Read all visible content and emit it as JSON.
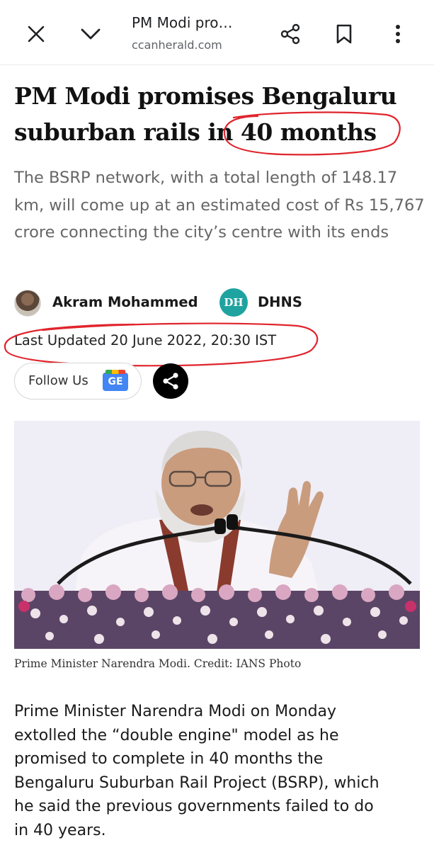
{
  "browser": {
    "title": "PM Modi pro…",
    "url": "ccanherald.com"
  },
  "icons": {
    "close": "close-icon",
    "chevron": "chevron-down-icon",
    "share": "share-icon",
    "bookmark": "bookmark-icon",
    "more": "more-vert-icon"
  },
  "article": {
    "headline_line1": "PM Modi promises Bengaluru",
    "headline_line2": "suburban rails in 40 months",
    "summary": "The BSRP network, with a total length of 148.17 km, will come up at an estimated cost of Rs 15,767 crore connecting the city’s centre with its ends",
    "author": "Akram Mohammed",
    "agency_logo": "DH",
    "agency": "DHNS",
    "updated": "Last Updated 20 June 2022, 20:30 IST",
    "follow_label": "Follow Us",
    "gnews_label": "GE",
    "caption": "Prime Minister Narendra Modi. Credit: IANS Photo",
    "body_lines": [
      "Prime Minister Narendra Modi on Monday",
      "extolled the “double engine\" model as he",
      "promised to complete in 40 months the",
      "Bengaluru Suburban Rail Project (BSRP), which",
      "he said the previous governments failed to do",
      "in 40 years."
    ]
  },
  "colors": {
    "annotation_red": "#e0242c",
    "dh_teal": "#1fa3a0"
  }
}
